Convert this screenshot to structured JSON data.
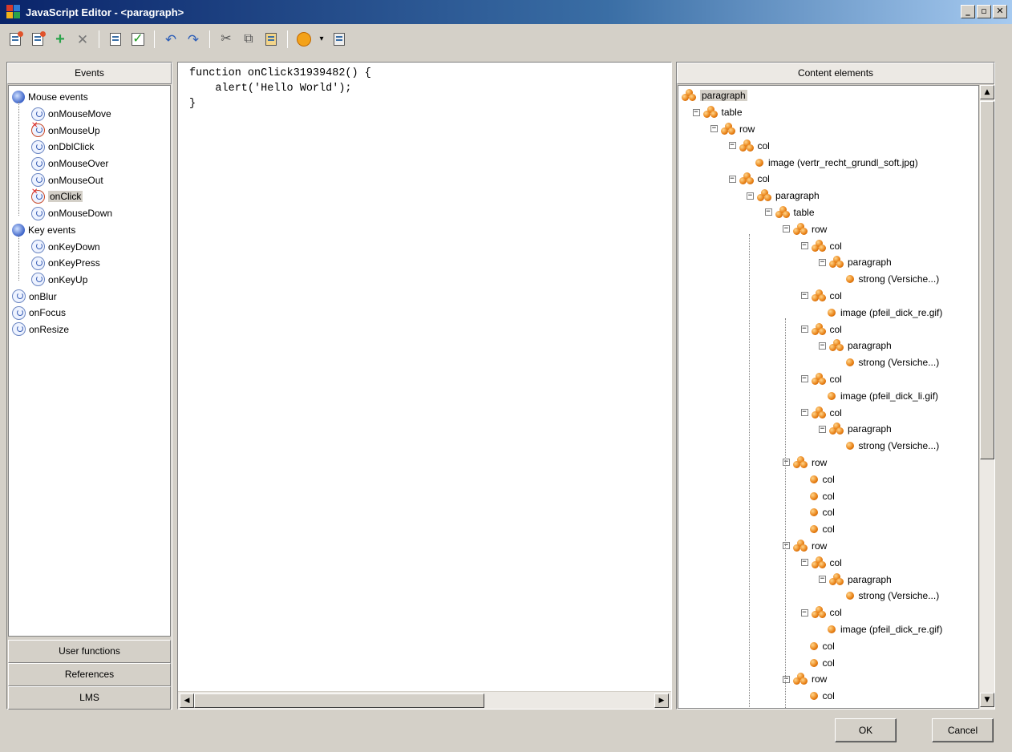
{
  "window": {
    "title": "JavaScript Editor - <paragraph>",
    "controls": {
      "minimize": "_",
      "restore": "▫",
      "close": "✕"
    }
  },
  "toolbar": {
    "buttons": [
      {
        "icon": "import-icon",
        "glyph": "📤"
      },
      {
        "icon": "export-icon",
        "glyph": "📥"
      },
      {
        "icon": "add-icon",
        "glyph": "✚"
      },
      {
        "icon": "delete-icon",
        "glyph": "✕"
      },
      {
        "icon": "document-icon",
        "glyph": ""
      },
      {
        "icon": "check-syntax-icon",
        "glyph": "✔"
      },
      {
        "icon": "undo-icon",
        "glyph": "↶"
      },
      {
        "icon": "redo-icon",
        "glyph": "↷"
      },
      {
        "icon": "cut-icon",
        "glyph": "✂"
      },
      {
        "icon": "copy-icon",
        "glyph": "⧉"
      },
      {
        "icon": "paste-icon",
        "glyph": "📋"
      },
      {
        "icon": "emoticon-icon",
        "glyph": ""
      },
      {
        "icon": "dropdown-arrow-icon",
        "glyph": "▾"
      },
      {
        "icon": "clear-icon",
        "glyph": "🖌"
      }
    ]
  },
  "left_panel": {
    "header": "Events",
    "tree": [
      {
        "label": "Mouse events",
        "level": 0,
        "type": "category"
      },
      {
        "label": "onMouseMove",
        "level": 1,
        "type": "event"
      },
      {
        "label": "onMouseUp",
        "level": 1,
        "type": "event",
        "has_handler": true
      },
      {
        "label": "onDblClick",
        "level": 1,
        "type": "event"
      },
      {
        "label": "onMouseOver",
        "level": 1,
        "type": "event"
      },
      {
        "label": "onMouseOut",
        "level": 1,
        "type": "event"
      },
      {
        "label": "onClick",
        "level": 1,
        "type": "event",
        "has_handler": true,
        "selected": true
      },
      {
        "label": "onMouseDown",
        "level": 1,
        "type": "event"
      },
      {
        "label": "Key events",
        "level": 0,
        "type": "category"
      },
      {
        "label": "onKeyDown",
        "level": 1,
        "type": "event"
      },
      {
        "label": "onKeyPress",
        "level": 1,
        "type": "event"
      },
      {
        "label": "onKeyUp",
        "level": 1,
        "type": "event"
      },
      {
        "label": "onBlur",
        "level": 0,
        "type": "event"
      },
      {
        "label": "onFocus",
        "level": 0,
        "type": "event"
      },
      {
        "label": "onResize",
        "level": 0,
        "type": "event"
      }
    ],
    "accordion": [
      "User functions",
      "References",
      "LMS"
    ]
  },
  "editor": {
    "code": "function onClick31939482() {\n    alert('Hello World');\n}"
  },
  "right_panel": {
    "header": "Content elements",
    "tree": [
      {
        "label": "paragraph",
        "level": 0,
        "type": "node",
        "selected": true
      },
      {
        "label": "table",
        "level": 1,
        "type": "node",
        "expander": true
      },
      {
        "label": "row",
        "level": 2,
        "type": "node",
        "expander": true
      },
      {
        "label": "col",
        "level": 3,
        "type": "node",
        "expander": true
      },
      {
        "label": "image (vertr_recht_grundl_soft.jpg)",
        "level": 4,
        "type": "leaf"
      },
      {
        "label": "col",
        "level": 3,
        "type": "node",
        "expander": true
      },
      {
        "label": "paragraph",
        "level": 4,
        "type": "node",
        "expander": true
      },
      {
        "label": "table",
        "level": 5,
        "type": "node",
        "expander": true
      },
      {
        "label": "row",
        "level": 6,
        "type": "node",
        "expander": true
      },
      {
        "label": "col",
        "level": 7,
        "type": "node",
        "expander": true
      },
      {
        "label": "paragraph",
        "level": 8,
        "type": "node",
        "expander": true
      },
      {
        "label": "strong (Versiche...)",
        "level": 9,
        "type": "leaf"
      },
      {
        "label": "col",
        "level": 7,
        "type": "node",
        "expander": true
      },
      {
        "label": "image (pfeil_dick_re.gif)",
        "level": 8,
        "type": "leaf"
      },
      {
        "label": "col",
        "level": 7,
        "type": "node",
        "expander": true
      },
      {
        "label": "paragraph",
        "level": 8,
        "type": "node",
        "expander": true
      },
      {
        "label": "strong (Versiche...)",
        "level": 9,
        "type": "leaf"
      },
      {
        "label": "col",
        "level": 7,
        "type": "node",
        "expander": true
      },
      {
        "label": "image (pfeil_dick_li.gif)",
        "level": 8,
        "type": "leaf"
      },
      {
        "label": "col",
        "level": 7,
        "type": "node",
        "expander": true
      },
      {
        "label": "paragraph",
        "level": 8,
        "type": "node",
        "expander": true
      },
      {
        "label": "strong (Versiche...)",
        "level": 9,
        "type": "leaf"
      },
      {
        "label": "row",
        "level": 6,
        "type": "node",
        "expander": true
      },
      {
        "label": "col",
        "level": 7,
        "type": "leaf"
      },
      {
        "label": "col",
        "level": 7,
        "type": "leaf"
      },
      {
        "label": "col",
        "level": 7,
        "type": "leaf"
      },
      {
        "label": "col",
        "level": 7,
        "type": "leaf"
      },
      {
        "label": "row",
        "level": 6,
        "type": "node",
        "expander": true
      },
      {
        "label": "col",
        "level": 7,
        "type": "node",
        "expander": true
      },
      {
        "label": "paragraph",
        "level": 8,
        "type": "node",
        "expander": true
      },
      {
        "label": "strong (Versiche...)",
        "level": 9,
        "type": "leaf"
      },
      {
        "label": "col",
        "level": 7,
        "type": "node",
        "expander": true
      },
      {
        "label": "image (pfeil_dick_re.gif)",
        "level": 8,
        "type": "leaf"
      },
      {
        "label": "col",
        "level": 7,
        "type": "leaf"
      },
      {
        "label": "col",
        "level": 7,
        "type": "leaf"
      },
      {
        "label": "row",
        "level": 6,
        "type": "node",
        "expander": true
      },
      {
        "label": "col",
        "level": 7,
        "type": "leaf"
      }
    ]
  },
  "buttons": {
    "ok": "OK",
    "cancel": "Cancel"
  }
}
